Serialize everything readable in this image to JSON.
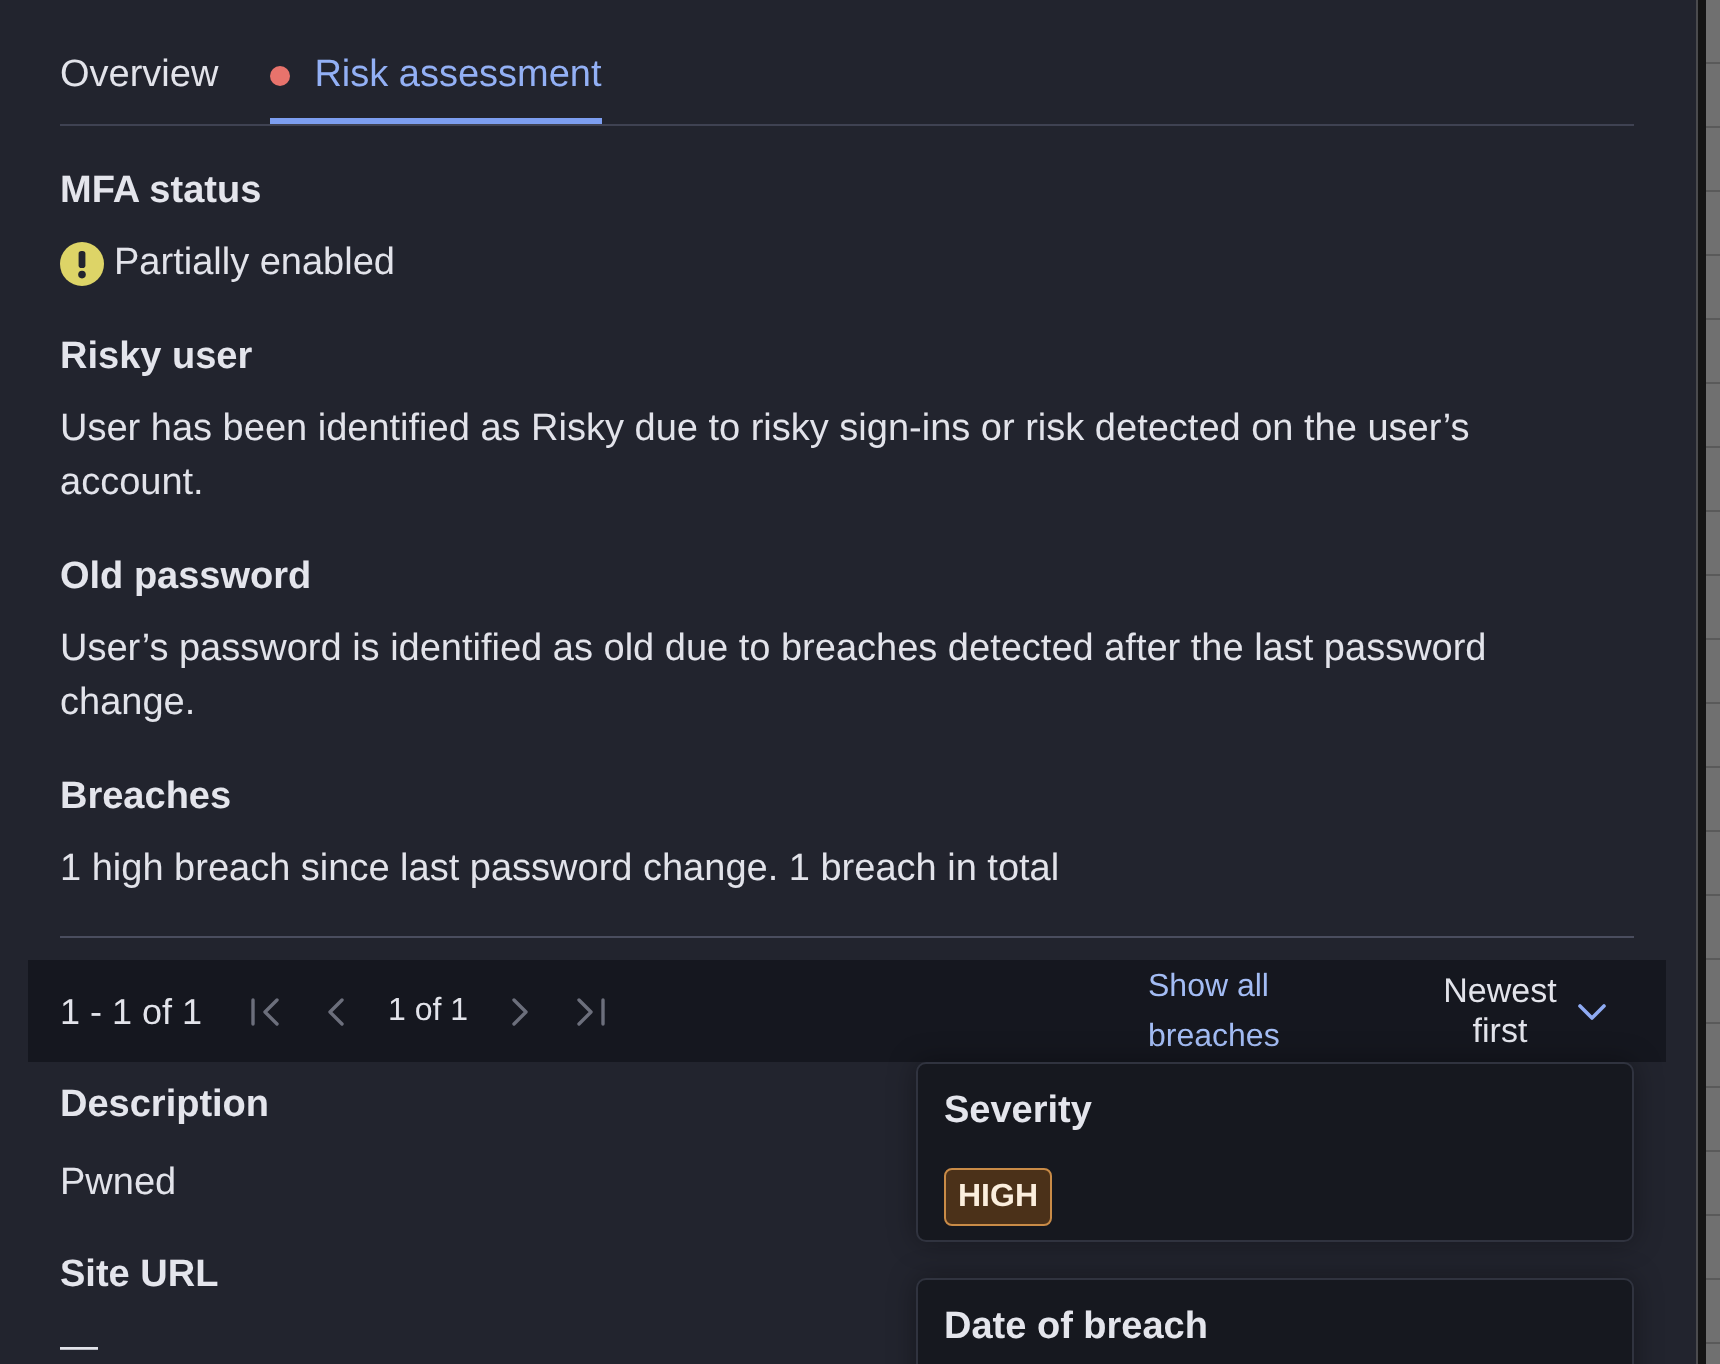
{
  "tabs": [
    {
      "label": "Overview",
      "selected": false,
      "alert": false
    },
    {
      "label": "Risk assessment",
      "selected": true,
      "alert": true
    }
  ],
  "sections": [
    {
      "kind": "status",
      "title": "MFA status",
      "warning": true,
      "value": "Partially enabled"
    },
    {
      "kind": "text",
      "title": "Risky user",
      "value": "User has been identified as Risky due to risky sign-ins or risk detected on the user’s account."
    },
    {
      "kind": "text",
      "title": "Old password",
      "value": "User’s password is identified as old due to breaches detected after the last password change."
    },
    {
      "kind": "text",
      "title": "Breaches",
      "value": "1 high breach since last password change. 1 breach in total"
    }
  ],
  "pagination": {
    "range": "1 - 1 of 1",
    "page": "1 of 1",
    "buttons": [
      {
        "kind": "first",
        "disabled": true
      },
      {
        "kind": "previous",
        "disabled": true
      },
      {
        "kind": "next",
        "disabled": true
      },
      {
        "kind": "last",
        "disabled": true
      }
    ],
    "link": "Show all breaches",
    "sort": "Newest first"
  },
  "breach": {
    "fields": [
      {
        "label": "Description",
        "value": "Pwned"
      },
      {
        "label": "Site URL",
        "value": "—"
      }
    ],
    "cards": [
      {
        "kind": "badge",
        "label": "Severity",
        "value": "HIGH"
      },
      {
        "kind": "text",
        "label": "Date of breach"
      }
    ]
  }
}
